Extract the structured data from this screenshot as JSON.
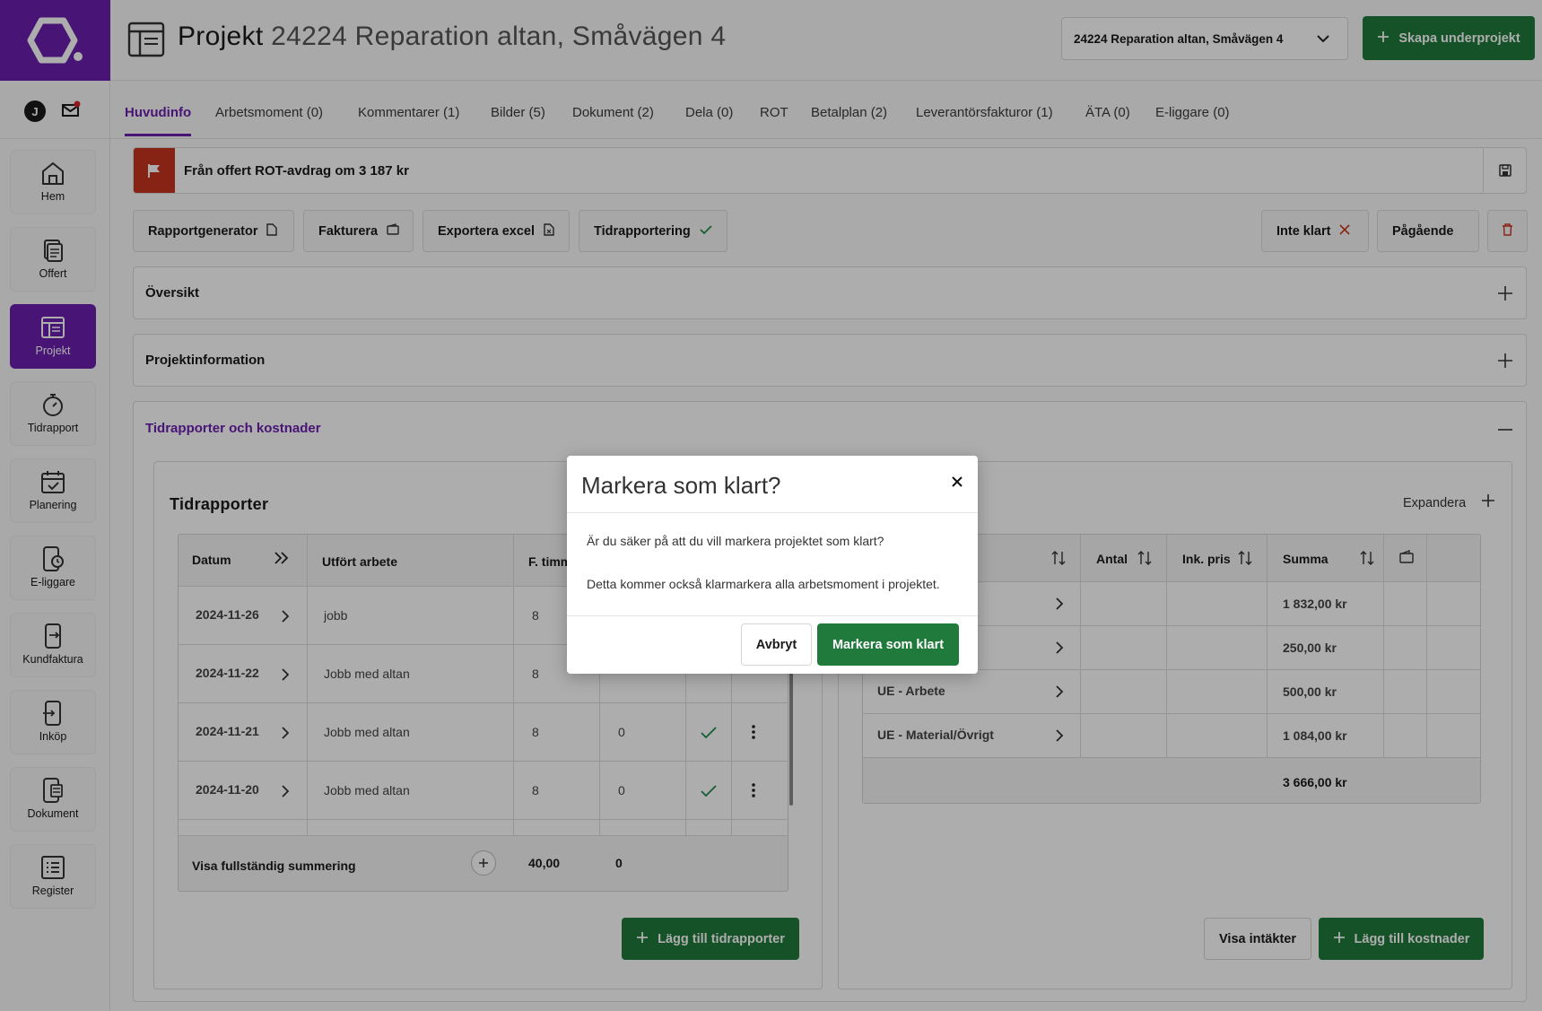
{
  "header": {
    "title_prefix": "Projekt",
    "title_project": "24224 Reparation altan, Småvägen 4",
    "project_select_value": "24224 Reparation altan, Småvägen 4",
    "create_subproject_label": "Skapa underprojekt"
  },
  "user": {
    "avatar_initial": "J"
  },
  "sidebar": {
    "items": [
      {
        "label": "Hem",
        "icon": "home-icon"
      },
      {
        "label": "Offert",
        "icon": "document-stack-icon"
      },
      {
        "label": "Projekt",
        "icon": "layout-icon",
        "active": true
      },
      {
        "label": "Tidrapport",
        "icon": "stopwatch-icon"
      },
      {
        "label": "Planering",
        "icon": "calendar-check-icon"
      },
      {
        "label": "E-liggare",
        "icon": "phone-clock-icon"
      },
      {
        "label": "Kundfaktura",
        "icon": "phone-arrow-icon"
      },
      {
        "label": "Inköp",
        "icon": "phone-in-icon"
      },
      {
        "label": "Dokument",
        "icon": "phone-doc-icon"
      },
      {
        "label": "Register",
        "icon": "list-icon"
      }
    ]
  },
  "tabs": [
    {
      "label": "Huvudinfo",
      "active": true
    },
    {
      "label": "Arbetsmoment (0)"
    },
    {
      "label": "Kommentarer (1)"
    },
    {
      "label": "Bilder (5)"
    },
    {
      "label": "Dokument (2)"
    },
    {
      "label": "Dela (0)"
    },
    {
      "label": "ROT"
    },
    {
      "label": "Betalplan (2)"
    },
    {
      "label": "Leverantörsfakturor (1)"
    },
    {
      "label": "ÄTA (0)"
    },
    {
      "label": "E-liggare (0)"
    }
  ],
  "rot_banner": "Från offert ROT-avdrag om 3 187 kr",
  "toolbar": {
    "report_generator": "Rapportgenerator",
    "invoice": "Fakturera",
    "export_excel": "Exportera excel",
    "time_reporting": "Tidrapportering",
    "not_done": "Inte klart",
    "ongoing": "Pågående"
  },
  "sections": {
    "overview": "Översikt",
    "project_info": "Projektinformation",
    "time_and_costs": "Tidrapporter och kostnader"
  },
  "time_reports": {
    "title": "Tidrapporter",
    "headers": {
      "date": "Datum",
      "work": "Utfört arbete",
      "hours": "F. timm"
    },
    "rows": [
      {
        "date": "2024-11-26",
        "work": "jobb",
        "hours": "8"
      },
      {
        "date": "2024-11-22",
        "work": "Jobb med altan",
        "hours": "8"
      },
      {
        "date": "2024-11-21",
        "work": "Jobb med altan",
        "hours": "8",
        "extra": "0"
      },
      {
        "date": "2024-11-20",
        "work": "Jobb med altan",
        "hours": "8",
        "extra": "0"
      }
    ],
    "summary_label": "Visa fullständig summering",
    "summary_hours": "40,00",
    "summary_extra": "0",
    "add_button": "Lägg till tidrapporter"
  },
  "costs": {
    "expand_label": "Expandera",
    "headers": {
      "qty": "Antal",
      "price": "Ink. pris",
      "sum": "Summa"
    },
    "rows": [
      {
        "name": "",
        "sum": "1 832,00 kr"
      },
      {
        "name": "",
        "sum": "250,00 kr"
      },
      {
        "name": "UE - Arbete",
        "sum": "500,00 kr"
      },
      {
        "name": "UE - Material/Övrigt",
        "sum": "1 084,00 kr"
      }
    ],
    "total": "3 666,00 kr",
    "show_income_button": "Visa intäkter",
    "add_button": "Lägg till kostnader"
  },
  "modal": {
    "title": "Markera som klart?",
    "text1": "Är du säker på att du vill markera projektet som klart?",
    "text2": "Detta kommer också klarmarkera alla arbetsmoment i projektet.",
    "cancel": "Avbryt",
    "confirm": "Markera som klart"
  },
  "colors": {
    "brand": "#6a1fb0",
    "primary_button": "#1f7a3c",
    "flag": "#c8341e",
    "check": "#1f8a4c"
  }
}
